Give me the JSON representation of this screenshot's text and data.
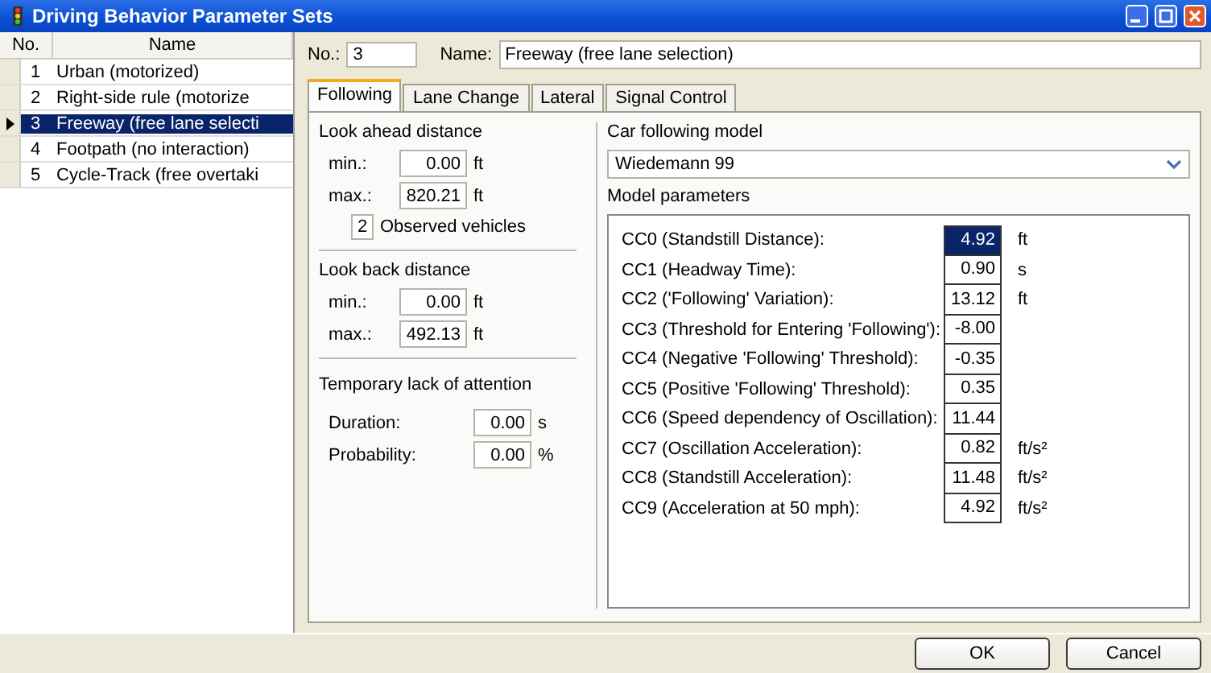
{
  "window": {
    "title": "Driving Behavior Parameter Sets"
  },
  "list": {
    "columns": [
      "No.",
      "Name"
    ],
    "rows": [
      {
        "no": "1",
        "name": "Urban (motorized)",
        "selected": false
      },
      {
        "no": "2",
        "name": "Right-side rule (motorize",
        "selected": false
      },
      {
        "no": "3",
        "name": "Freeway (free lane selecti",
        "selected": true
      },
      {
        "no": "4",
        "name": "Footpath (no interaction)",
        "selected": false
      },
      {
        "no": "5",
        "name": "Cycle-Track (free overtaki",
        "selected": false
      }
    ]
  },
  "header": {
    "no_label": "No.:",
    "no_value": "3",
    "name_label": "Name:",
    "name_value": "Freeway (free lane selection)"
  },
  "tabs": [
    {
      "label": "Following",
      "selected": true
    },
    {
      "label": "Lane Change",
      "selected": false
    },
    {
      "label": "Lateral",
      "selected": false
    },
    {
      "label": "Signal Control",
      "selected": false
    }
  ],
  "look_ahead": {
    "title": "Look ahead distance",
    "fields": [
      {
        "label": "min.:",
        "value": "0.00",
        "unit": "ft"
      },
      {
        "label": "max.:",
        "value": "820.21",
        "unit": "ft"
      }
    ],
    "observed_value": "2",
    "observed_label": "Observed vehicles"
  },
  "look_back": {
    "title": "Look back distance",
    "fields": [
      {
        "label": "min.:",
        "value": "0.00",
        "unit": "ft"
      },
      {
        "label": "max.:",
        "value": "492.13",
        "unit": "ft"
      }
    ]
  },
  "attention": {
    "title": "Temporary lack of attention",
    "fields": [
      {
        "label": "Duration:",
        "value": "0.00",
        "unit": "s"
      },
      {
        "label": "Probability:",
        "value": "0.00",
        "unit": "%"
      }
    ]
  },
  "model": {
    "label": "Car following model",
    "value": "Wiedemann 99",
    "params_label": "Model parameters",
    "params": [
      {
        "name": "CC0 (Standstill Distance):",
        "value": "4.92",
        "unit": "ft",
        "selected": true
      },
      {
        "name": "CC1 (Headway Time):",
        "value": "0.90",
        "unit": "s",
        "selected": false
      },
      {
        "name": "CC2 ('Following' Variation):",
        "value": "13.12",
        "unit": "ft",
        "selected": false
      },
      {
        "name": "CC3 (Threshold for Entering 'Following'):",
        "value": "-8.00",
        "selected": false
      },
      {
        "name": "CC4 (Negative 'Following' Threshold):",
        "value": "-0.35",
        "selected": false
      },
      {
        "name": "CC5 (Positive 'Following' Threshold):",
        "value": "0.35",
        "selected": false
      },
      {
        "name": "CC6 (Speed dependency of Oscillation):",
        "value": "11.44",
        "selected": false
      },
      {
        "name": "CC7 (Oscillation Acceleration):",
        "value": "0.82",
        "unit": "ft/s²",
        "selected": false
      },
      {
        "name": "CC8 (Standstill Acceleration):",
        "value": "11.48",
        "unit": "ft/s²",
        "selected": false
      },
      {
        "name": "CC9 (Acceleration at 50 mph):",
        "value": "4.92",
        "unit": "ft/s²",
        "selected": false
      }
    ]
  },
  "buttons": [
    "OK",
    "Cancel"
  ]
}
